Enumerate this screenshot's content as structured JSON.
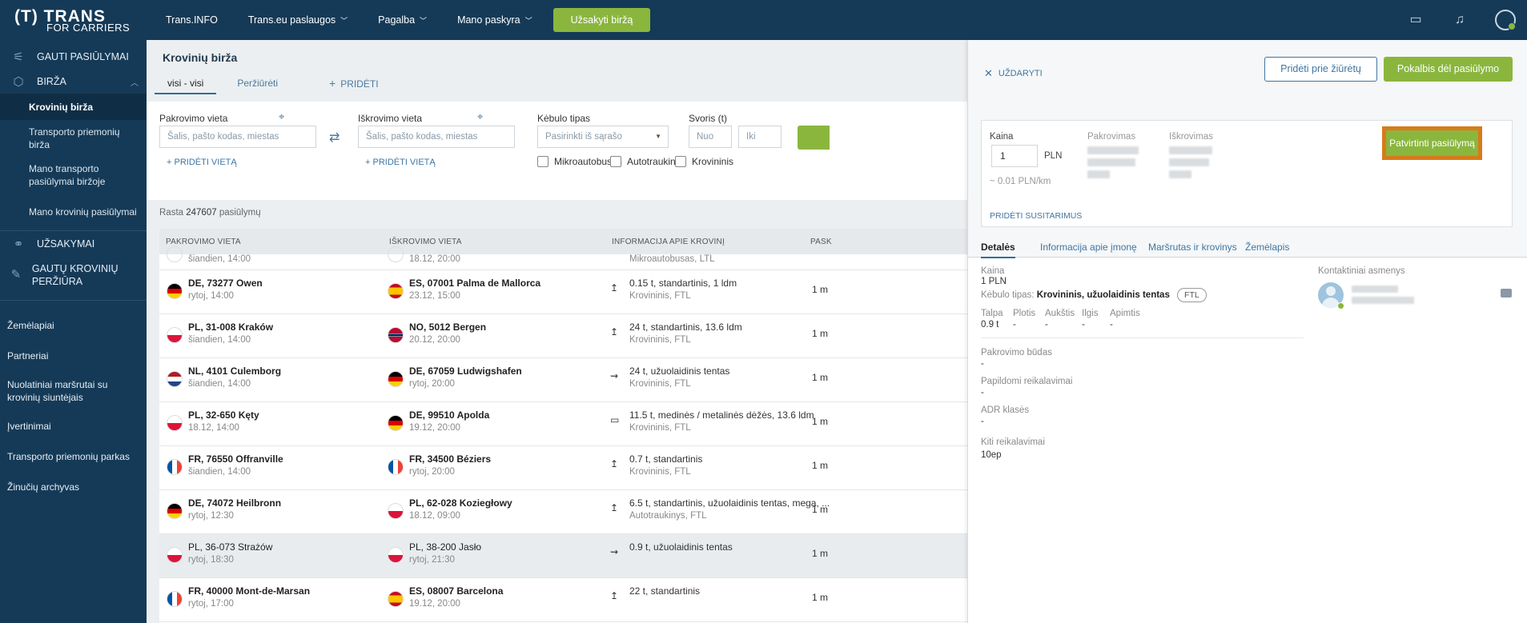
{
  "sidebar": {
    "logo_main": "(T) TRANS",
    "logo_sub": "FOR CARRIERS",
    "items": [
      {
        "label": "GAUTI PASIŪLYMAI",
        "icon": "offers-icon"
      },
      {
        "label": "BIRŽA",
        "icon": "box-icon"
      },
      {
        "label": "UŽSAKYMAI",
        "icon": "handshake-icon"
      },
      {
        "label": "GAUTŲ KROVINIŲ PERŽIŪRA",
        "icon": "eye-icon"
      }
    ],
    "birza_sub": [
      "Krovinių birža",
      "Transporto priemonių birža",
      "Mano transporto pasiūlymai biržoje",
      "Mano krovinių pasiūlymai"
    ],
    "plain": [
      "Žemėlapiai",
      "Partneriai",
      "Nuolatiniai maršrutai su krovinių siuntėjais",
      "Įvertinimai",
      "Transporto priemonių parkas",
      "Žinučių archyvas"
    ]
  },
  "topbar": {
    "links": [
      "Trans.INFO",
      "Trans.eu paslaugos",
      "Pagalba",
      "Mano paskyra"
    ],
    "order_button": "Užsakyti biržą"
  },
  "main": {
    "title": "Krovinių birža",
    "tabs": [
      "visi - visi",
      "Peržiūrėti",
      "PRIDĖTI"
    ],
    "filter": {
      "pickup_label": "Pakrovimo vieta",
      "unload_label": "Iškrovimo vieta",
      "placeholder_place": "Šalis, pašto kodas, miestas",
      "body_label": "Kėbulo tipas",
      "body_placeholder": "Pasirinkti iš sąrašo",
      "weight_label": "Svoris (t)",
      "weight_from": "Nuo",
      "weight_to": "Iki",
      "add_place": "PRIDĖTI VIETĄ",
      "checks": [
        "Mikroautobusas",
        "Autotraukinys",
        "Krovininis"
      ]
    },
    "found_prefix": "Rasta",
    "found_count": "247607",
    "found_suffix": "pasiūlymų",
    "headers": [
      "PAKROVIMO VIETA",
      "IŠKROVIMO VIETA",
      "INFORMACIJA APIE KROVINĮ",
      "PASK"
    ],
    "partial_row": {
      "from_when": "šiandien, 14:00",
      "to_when": "18.12, 20:00",
      "cargo2": "Mikroautobusas, LTL"
    },
    "rows": [
      {
        "from": "DE, 73277 Owen",
        "from_when": "rytoj, 14:00",
        "from_flag": "de",
        "to": "ES, 07001 Palma de Mallorca",
        "to_when": "23.12, 15:00",
        "to_flag": "es",
        "cargo1": "0.15 t, standartinis, 1 ldm",
        "cargo2": "Krovininis, FTL",
        "m": "1 m"
      },
      {
        "from": "PL, 31-008 Kraków",
        "from_when": "šiandien, 14:00",
        "from_flag": "pl",
        "to": "NO, 5012 Bergen",
        "to_when": "20.12, 20:00",
        "to_flag": "no",
        "cargo1": "24 t, standartinis, 13.6 ldm",
        "cargo2": "Krovininis, FTL",
        "m": "1 m"
      },
      {
        "from": "NL, 4101 Culemborg",
        "from_when": "šiandien, 14:00",
        "from_flag": "nl",
        "to": "DE, 67059 Ludwigshafen",
        "to_when": "rytoj, 20:00",
        "to_flag": "de",
        "cargo1": "24 t, užuolaidinis tentas",
        "cargo2": "Krovininis, FTL",
        "m": "1 m"
      },
      {
        "from": "PL, 32-650 Kęty",
        "from_when": "18.12, 14:00",
        "from_flag": "pl",
        "to": "DE, 99510 Apolda",
        "to_when": "19.12, 20:00",
        "to_flag": "de",
        "cargo1": "11.5 t, medinės / metalinės dėžės, 13.6 ldm",
        "cargo2": "Krovininis, FTL",
        "m": "1 m"
      },
      {
        "from": "FR, 76550 Offranville",
        "from_when": "šiandien, 14:00",
        "from_flag": "fr",
        "to": "FR, 34500 Béziers",
        "to_when": "rytoj, 20:00",
        "to_flag": "fr",
        "cargo1": "0.7 t, standartinis",
        "cargo2": "Krovininis, FTL",
        "m": "1 m"
      },
      {
        "from": "DE, 74072 Heilbronn",
        "from_when": "rytoj, 12:30",
        "from_flag": "de",
        "to": "PL, 62-028 Koziegłowy",
        "to_when": "18.12, 09:00",
        "to_flag": "pl",
        "cargo1": "6.5 t, standartinis, užuolaidinis tentas, mega, ...",
        "cargo2": "Autotraukinys, FTL",
        "m": "1 m"
      },
      {
        "from": "PL, 36-073 Strażów",
        "from_when": "rytoj, 18:30",
        "from_flag": "pl",
        "to": "PL, 38-200 Jasło",
        "to_when": "rytoj, 21:30",
        "to_flag": "pl",
        "cargo1": "0.9 t, užuolaidinis tentas",
        "cargo2": "",
        "m": "1 m"
      },
      {
        "from": "FR, 40000 Mont-de-Marsan",
        "from_when": "rytoj, 17:00",
        "from_flag": "fr",
        "to": "ES, 08007 Barcelona",
        "to_when": "19.12, 20:00",
        "to_flag": "es",
        "cargo1": "22 t, standartinis",
        "cargo2": "",
        "m": "1 m"
      }
    ]
  },
  "panel": {
    "close": "UŽDARYTI",
    "watch_button": "Pridėti prie žiūrėtų",
    "chat_button": "Pokalbis dėl pasiūlymo",
    "price_label": "Kaina",
    "price_value": "1",
    "currency": "PLN",
    "per_km": "~ 0.01 PLN/km",
    "loading_label": "Pakrovimas",
    "unloading_label": "Iškrovimas",
    "confirm_button": "Patvirtinti pasiūlymą",
    "add_terms": "PRIDĖTI SUSITARIMUS",
    "tabs": [
      "Detalės",
      "Informacija apie įmonę",
      "Maršrutas ir krovinys",
      "Žemėlapis"
    ],
    "details": {
      "price_label": "Kaina",
      "price_value": "1 PLN",
      "body_label": "Kėbulo tipas:",
      "body_value": "Krovininis, užuolaidinis tentas",
      "ftl": "FTL",
      "dims_labels": [
        "Talpa",
        "Plotis",
        "Aukštis",
        "Ilgis",
        "Apimtis"
      ],
      "dims_values": [
        "0.9 t",
        "-",
        "-",
        "-",
        "-"
      ],
      "loading_method_label": "Pakrovimo būdas",
      "loading_method_value": "-",
      "extra_label": "Papildomi reikalavimai",
      "extra_value": "-",
      "adr_label": "ADR klasės",
      "adr_value": "-",
      "other_label": "Kiti reikalavimai",
      "other_value": "10ep",
      "contacts_label": "Kontaktiniai asmenys"
    }
  }
}
